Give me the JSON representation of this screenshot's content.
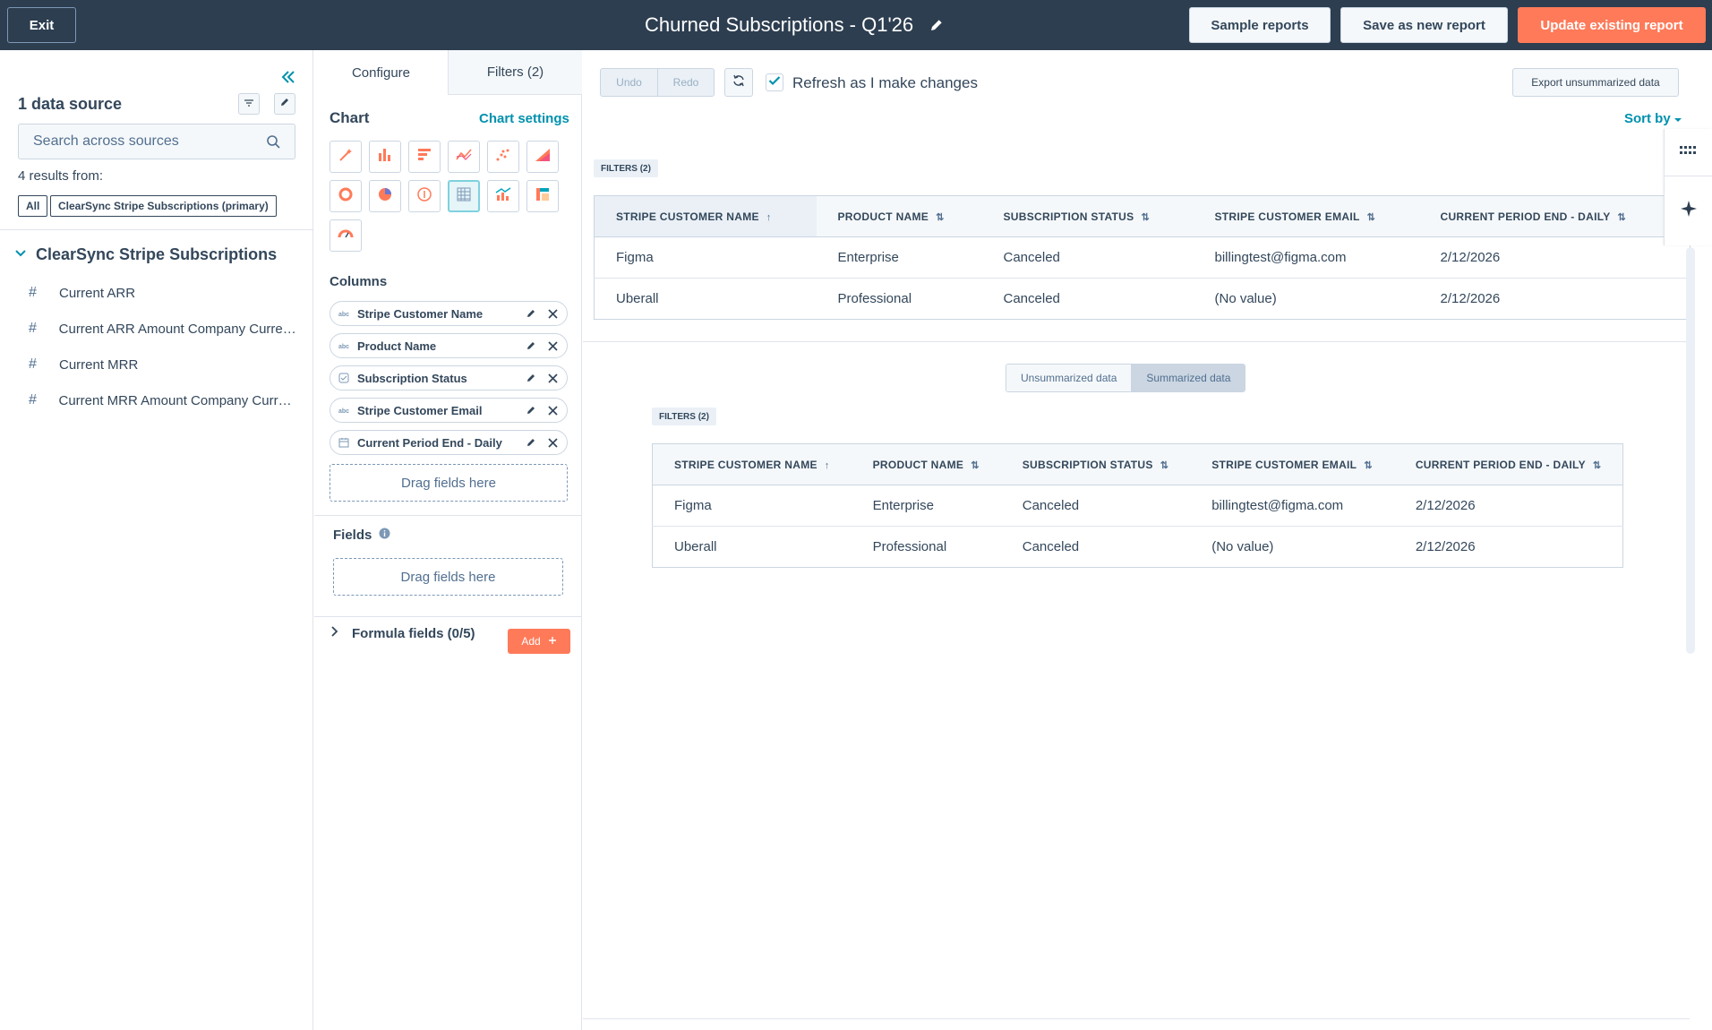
{
  "topbar": {
    "exit_label": "Exit",
    "report_title": "Churned Subscriptions - Q1'26",
    "sample_reports_label": "Sample reports",
    "save_new_label": "Save as new report",
    "update_label": "Update existing report"
  },
  "left_panel": {
    "data_source_title": "1 data source",
    "search_placeholder": "Search across sources",
    "results_from": "4 results from:",
    "chips": {
      "all": "All",
      "primary": "ClearSync Stripe Subscriptions (primary)"
    },
    "group_title": "ClearSync Stripe Subscriptions",
    "fields": [
      {
        "icon": "#",
        "label": "Current ARR"
      },
      {
        "icon": "#",
        "label": "Current ARR Amount Company Currency"
      },
      {
        "icon": "#",
        "label": "Current MRR"
      },
      {
        "icon": "#",
        "label": "Current MRR Amount Company Currency"
      }
    ]
  },
  "mid_panel": {
    "tabs": {
      "configure": "Configure",
      "filters": "Filters (2)"
    },
    "chart_label": "Chart",
    "chart_settings": "Chart settings",
    "chart_types": [
      "magic-wand",
      "vertical-bar",
      "horizontal-bar",
      "line",
      "scatter",
      "area",
      "donut",
      "pie",
      "kpi",
      "table",
      "combo",
      "pivot",
      "gauge"
    ],
    "active_chart_type": "table",
    "columns_label": "Columns",
    "columns": [
      {
        "type": "text",
        "label": "Stripe Customer Name"
      },
      {
        "type": "text",
        "label": "Product Name"
      },
      {
        "type": "enum",
        "label": "Subscription Status"
      },
      {
        "type": "text",
        "label": "Stripe Customer Email"
      },
      {
        "type": "date",
        "label": "Current Period End - Daily"
      }
    ],
    "drag_columns": "Drag fields here",
    "fields_label": "Fields",
    "drag_fields": "Drag fields here",
    "formula_label": "Formula fields (0/5)",
    "add_label": "Add"
  },
  "content": {
    "undo": "Undo",
    "redo": "Redo",
    "refresh_label": "Refresh as I make changes",
    "refresh_checked": true,
    "export_label": "Export unsummarized data",
    "sort_by": "Sort by",
    "filters_tag": "FILTERS (2)",
    "headers": [
      "STRIPE CUSTOMER NAME",
      "PRODUCT NAME",
      "SUBSCRIPTION STATUS",
      "STRIPE CUSTOMER EMAIL",
      "CURRENT PERIOD END - DAILY"
    ],
    "rows": [
      [
        "Figma",
        "Enterprise",
        "Canceled",
        "billingtest@figma.com",
        "2/12/2026"
      ],
      [
        "Uberall",
        "Professional",
        "Canceled",
        "(No value)",
        "2/12/2026"
      ]
    ],
    "toggle": {
      "unsummarized": "Unsummarized data",
      "summarized": "Summarized data",
      "active": "summarized"
    },
    "filters_tag_2": "FILTERS (2)",
    "headers_2": [
      "STRIPE CUSTOMER NAME",
      "PRODUCT NAME",
      "SUBSCRIPTION STATUS",
      "STRIPE CUSTOMER EMAIL",
      "CURRENT PERIOD END - DAILY"
    ],
    "rows_2": [
      [
        "Figma",
        "Enterprise",
        "Canceled",
        "billingtest@figma.com",
        "2/12/2026"
      ],
      [
        "Uberall",
        "Professional",
        "Canceled",
        "(No value)",
        "2/12/2026"
      ]
    ]
  },
  "colors": {
    "topbar": "#2d3e50",
    "accent": "#ff7a59",
    "link": "#0091ae",
    "text": "#33475b",
    "border": "#cbd6e2"
  }
}
